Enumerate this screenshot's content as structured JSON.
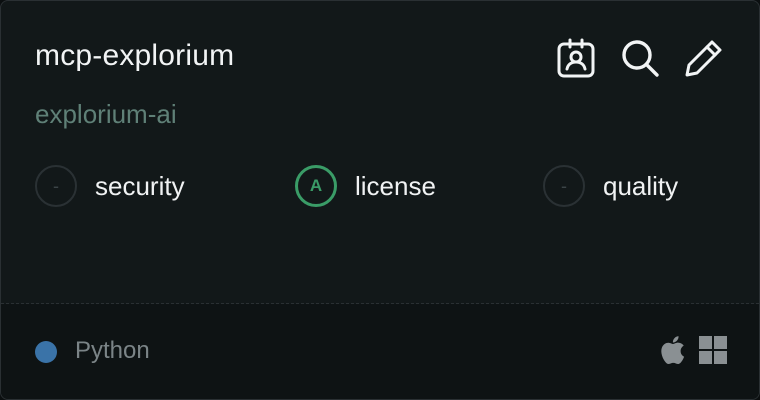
{
  "server": {
    "name": "mcp-explorium",
    "owner": "explorium-ai"
  },
  "actions": [
    {
      "icon": "id-badge-icon"
    },
    {
      "icon": "search-icon"
    },
    {
      "icon": "pencil-icon"
    }
  ],
  "scores": [
    {
      "label": "security",
      "grade": "-",
      "status": "none"
    },
    {
      "label": "license",
      "grade": "A",
      "status": "good"
    },
    {
      "label": "quality",
      "grade": "-",
      "status": "none"
    }
  ],
  "footer": {
    "language": "Python",
    "language_color": "#3a73a8",
    "platforms": [
      "apple-icon",
      "windows-icon"
    ]
  },
  "colors": {
    "accent_good": "#3a9c67",
    "background": "#121819"
  }
}
